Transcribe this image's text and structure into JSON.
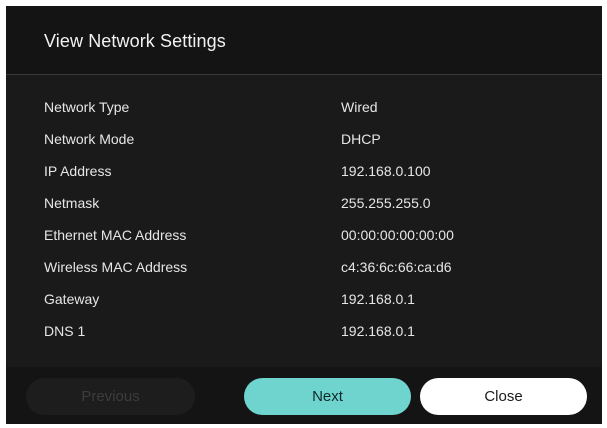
{
  "dialog": {
    "title": "View Network Settings"
  },
  "settings": [
    {
      "label": "Network Type",
      "value": "Wired"
    },
    {
      "label": "Network Mode",
      "value": "DHCP"
    },
    {
      "label": "IP Address",
      "value": "192.168.0.100"
    },
    {
      "label": "Netmask",
      "value": "255.255.255.0"
    },
    {
      "label": "Ethernet MAC Address",
      "value": "00:00:00:00:00:00"
    },
    {
      "label": "Wireless MAC Address",
      "value": "c4:36:6c:66:ca:d6"
    },
    {
      "label": "Gateway",
      "value": "192.168.0.1"
    },
    {
      "label": "DNS 1",
      "value": "192.168.0.1"
    }
  ],
  "buttons": {
    "previous": "Previous",
    "next": "Next",
    "close": "Close"
  },
  "colors": {
    "background": "#141414",
    "accent": "#6fd3ce",
    "close_button": "#ffffff"
  }
}
